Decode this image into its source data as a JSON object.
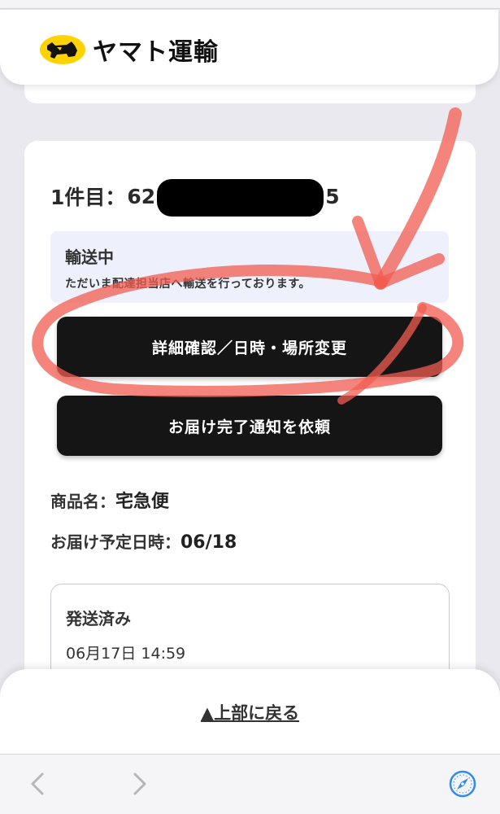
{
  "header": {
    "brand_name": "ヤマト運輸",
    "logo_icon": "black-cat-yellow-circle-icon"
  },
  "shipment": {
    "item_label": "1件目：",
    "tracking_prefix": "62",
    "tracking_suffix": "5",
    "status_title": "輸送中",
    "status_description": "ただいま配達担当店へ輸送を行っております。",
    "detail_button": "詳細確認／日時・場所変更",
    "notify_button": "お届け完了通知を依頼",
    "product_label": "商品名：",
    "product_value": "宅急便",
    "date_label": "お届け予定日時：",
    "date_value": "06/18"
  },
  "history": {
    "status": "発送済み",
    "datetime": "06月17日 14:59"
  },
  "footer": {
    "back_to_top": "▲上部に戻る"
  },
  "toolbar": {
    "back_icon": "chevron-left-icon",
    "forward_icon": "chevron-right-icon",
    "browser_icon": "compass-icon"
  },
  "colors": {
    "button_bg": "#151515",
    "status_bg": "#eef0fb",
    "annotation_red": "#f25c50",
    "logo_yellow": "#ffd200",
    "compass_blue": "#2f8bf0"
  }
}
